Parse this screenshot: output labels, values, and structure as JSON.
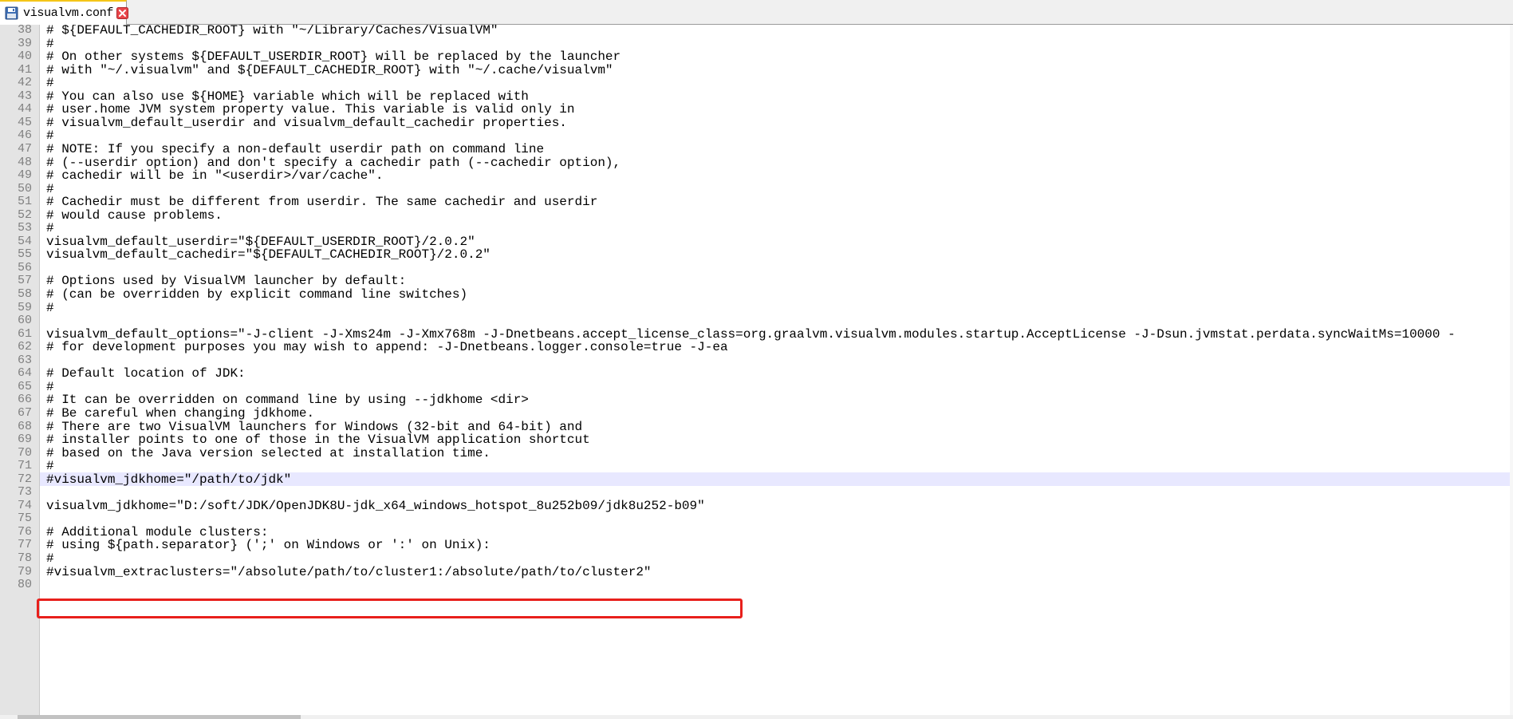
{
  "tab": {
    "filename": "visualvm.conf",
    "save_icon": "floppy-disk-icon",
    "close_icon": "close-icon"
  },
  "colors": {
    "highlight_border": "#e8201c",
    "current_line": "#e8e8ff",
    "gutter": "#e4e4e4"
  },
  "editor": {
    "current_line_number": "72",
    "highlighted_line_number": "74",
    "lines": [
      {
        "num": "38",
        "text": "# ${DEFAULT_CACHEDIR_ROOT} with \"~/Library/Caches/VisualVM\""
      },
      {
        "num": "39",
        "text": "#"
      },
      {
        "num": "40",
        "text": "# On other systems ${DEFAULT_USERDIR_ROOT} will be replaced by the launcher"
      },
      {
        "num": "41",
        "text": "# with \"~/.visualvm\" and ${DEFAULT_CACHEDIR_ROOT} with \"~/.cache/visualvm\""
      },
      {
        "num": "42",
        "text": "#"
      },
      {
        "num": "43",
        "text": "# You can also use ${HOME} variable which will be replaced with"
      },
      {
        "num": "44",
        "text": "# user.home JVM system property value. This variable is valid only in"
      },
      {
        "num": "45",
        "text": "# visualvm_default_userdir and visualvm_default_cachedir properties."
      },
      {
        "num": "46",
        "text": "#"
      },
      {
        "num": "47",
        "text": "# NOTE: If you specify a non-default userdir path on command line"
      },
      {
        "num": "48",
        "text": "# (--userdir option) and don't specify a cachedir path (--cachedir option),"
      },
      {
        "num": "49",
        "text": "# cachedir will be in \"<userdir>/var/cache\"."
      },
      {
        "num": "50",
        "text": "#"
      },
      {
        "num": "51",
        "text": "# Cachedir must be different from userdir. The same cachedir and userdir"
      },
      {
        "num": "52",
        "text": "# would cause problems."
      },
      {
        "num": "53",
        "text": "#"
      },
      {
        "num": "54",
        "text": "visualvm_default_userdir=\"${DEFAULT_USERDIR_ROOT}/2.0.2\""
      },
      {
        "num": "55",
        "text": "visualvm_default_cachedir=\"${DEFAULT_CACHEDIR_ROOT}/2.0.2\""
      },
      {
        "num": "56",
        "text": ""
      },
      {
        "num": "57",
        "text": "# Options used by VisualVM launcher by default:"
      },
      {
        "num": "58",
        "text": "# (can be overridden by explicit command line switches)"
      },
      {
        "num": "59",
        "text": "#"
      },
      {
        "num": "60",
        "text": ""
      },
      {
        "num": "61",
        "text": "visualvm_default_options=\"-J-client -J-Xms24m -J-Xmx768m -J-Dnetbeans.accept_license_class=org.graalvm.visualvm.modules.startup.AcceptLicense -J-Dsun.jvmstat.perdata.syncWaitMs=10000 -"
      },
      {
        "num": "62",
        "text": "# for development purposes you may wish to append: -J-Dnetbeans.logger.console=true -J-ea"
      },
      {
        "num": "63",
        "text": ""
      },
      {
        "num": "64",
        "text": "# Default location of JDK:"
      },
      {
        "num": "65",
        "text": "#"
      },
      {
        "num": "66",
        "text": "# It can be overridden on command line by using --jdkhome <dir>"
      },
      {
        "num": "67",
        "text": "# Be careful when changing jdkhome."
      },
      {
        "num": "68",
        "text": "# There are two VisualVM launchers for Windows (32-bit and 64-bit) and"
      },
      {
        "num": "69",
        "text": "# installer points to one of those in the VisualVM application shortcut"
      },
      {
        "num": "70",
        "text": "# based on the Java version selected at installation time."
      },
      {
        "num": "71",
        "text": "#"
      },
      {
        "num": "72",
        "text": "#visualvm_jdkhome=\"/path/to/jdk\""
      },
      {
        "num": "73",
        "text": ""
      },
      {
        "num": "74",
        "text": "visualvm_jdkhome=\"D:/soft/JDK/OpenJDK8U-jdk_x64_windows_hotspot_8u252b09/jdk8u252-b09\""
      },
      {
        "num": "75",
        "text": ""
      },
      {
        "num": "76",
        "text": "# Additional module clusters:"
      },
      {
        "num": "77",
        "text": "# using ${path.separator} (';' on Windows or ':' on Unix):"
      },
      {
        "num": "78",
        "text": "#"
      },
      {
        "num": "79",
        "text": "#visualvm_extraclusters=\"/absolute/path/to/cluster1:/absolute/path/to/cluster2\""
      },
      {
        "num": "80",
        "text": ""
      }
    ]
  }
}
